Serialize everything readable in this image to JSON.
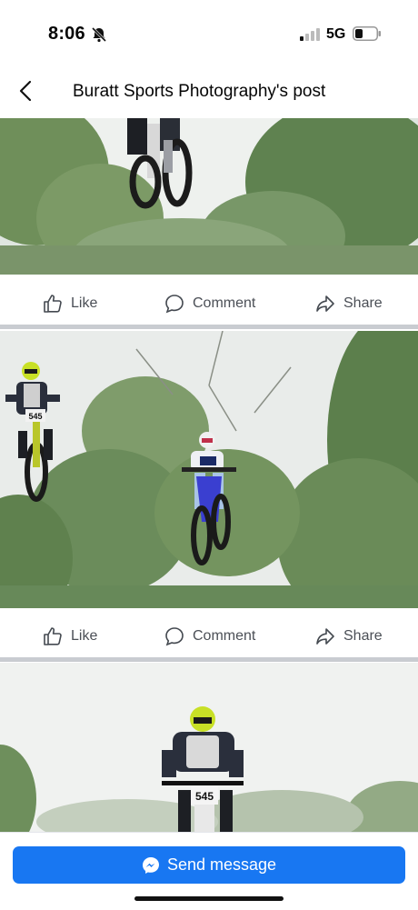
{
  "status_bar": {
    "time": "8:06",
    "network": "5G",
    "icons": [
      "bell-slash-icon",
      "signal-icon",
      "battery-icon"
    ]
  },
  "header": {
    "title": "Buratt Sports Photography's post",
    "back_icon": "chevron-left-icon"
  },
  "posts": [
    {
      "photo": "motocross-rider-airborne-cropped-top",
      "actions": {
        "like": "Like",
        "comment": "Comment",
        "share": "Share"
      }
    },
    {
      "photo": "two-motocross-riders-airborne",
      "rider_number": "545",
      "actions": {
        "like": "Like",
        "comment": "Comment",
        "share": "Share"
      }
    },
    {
      "photo": "motocross-rider-545-approaching",
      "rider_number": "545"
    }
  ],
  "footer": {
    "send_message": "Send message",
    "icon": "messenger-icon"
  },
  "colors": {
    "accent": "#1877f2",
    "divider": "#c9ccd1",
    "icon_gray": "#65676b"
  }
}
